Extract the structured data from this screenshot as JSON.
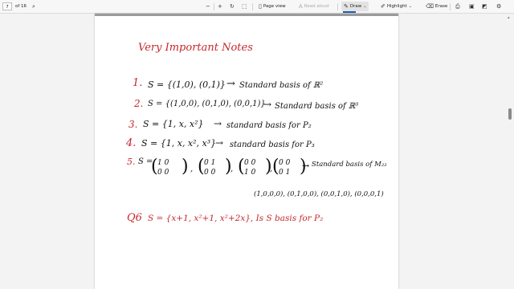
{
  "toolbar": {
    "page_number": "7",
    "page_of": "of 16",
    "page_view_label": "Page view",
    "read_aloud_label": "Read aloud",
    "draw_label": "Draw",
    "highlight_label": "Highlight",
    "erase_label": "Erase",
    "icons": [
      "search-icon",
      "minus-icon",
      "plus-icon",
      "rotate-icon",
      "fit-page-icon",
      "page-view-icon",
      "read-aloud-icon",
      "draw-icon",
      "chevron-down-icon",
      "highlight-icon",
      "chevron-down-icon",
      "erase-icon",
      "print-icon",
      "save-icon",
      "save-as-icon",
      "settings-icon"
    ]
  },
  "colors": {
    "ink_red": "#c8262c",
    "ink_black": "#111111",
    "accent_blue": "#1a5fb4"
  },
  "notes": {
    "title": "Very Important Notes",
    "items": [
      {
        "number": "1.",
        "set": "S = {(1,0), (0,1)}",
        "arrow": "→",
        "desc": "Standard basis of ℝ²"
      },
      {
        "number": "2.",
        "set": "S = {(1,0,0), (0,1,0), (0,0,1)}",
        "arrow": "→",
        "desc": "Standard basis of ℝ³"
      },
      {
        "number": "3.",
        "set": "S = {1, x, x²}",
        "arrow": "→",
        "desc": "standard basis for P₂"
      },
      {
        "number": "4.",
        "set": "S = {1, x, x², x³}",
        "arrow": "→",
        "desc": "standard basis for P₃"
      },
      {
        "number": "5.",
        "set": "S =",
        "arrow": "→",
        "desc": "Standard basis of M₂₂"
      }
    ],
    "matrices": [
      {
        "row1": "1  0",
        "row2": "0  0"
      },
      {
        "row1": "0  1",
        "row2": "0  0"
      },
      {
        "row1": "0  0",
        "row2": "1  0"
      },
      {
        "row1": "0  0",
        "row2": "0  1"
      }
    ],
    "matrix_tuples": "(1,0,0,0), (0,1,0,0), (0,0,1,0), (0,0,0,1)",
    "question_label": "Q6",
    "question_text": "S = {x+1, x²+1, x²+2x}, Is S basis for P₂"
  }
}
